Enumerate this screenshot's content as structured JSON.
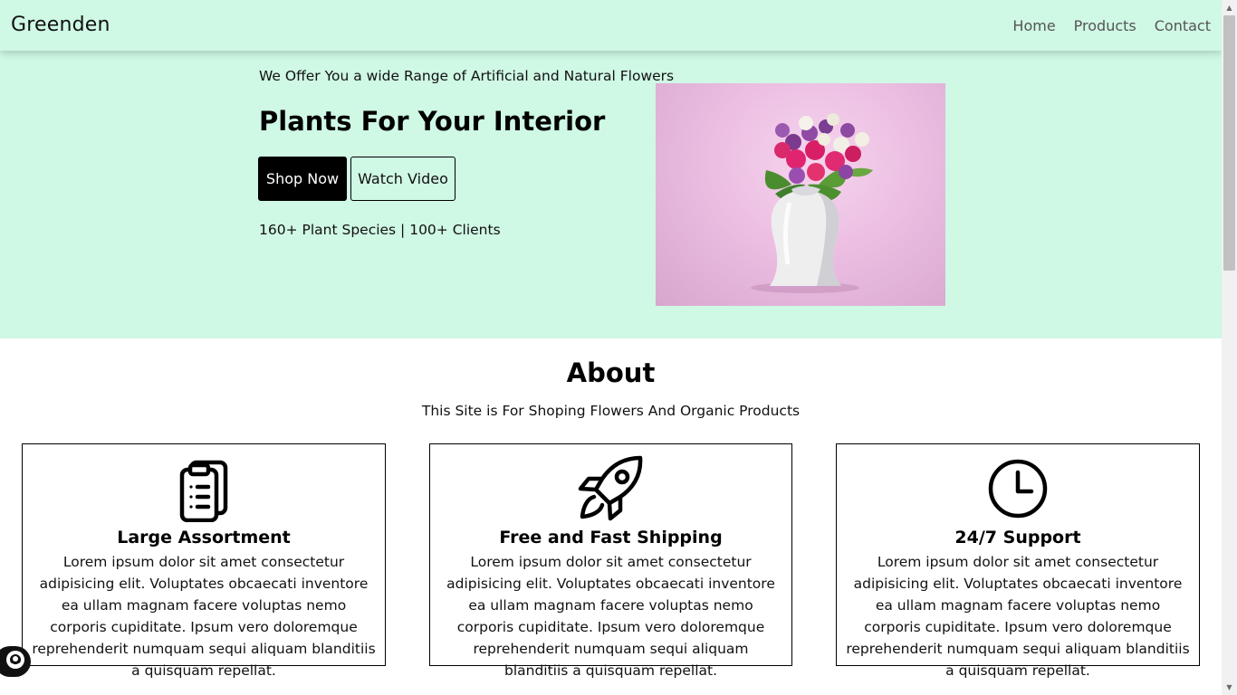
{
  "navbar": {
    "brand": "Greenden",
    "links": [
      "Home",
      "Products",
      "Contact"
    ]
  },
  "hero": {
    "subtitle": "We Offer You a wide Range of Artificial and Natural Flowers",
    "title": "Plants For Your Interior",
    "primary_button": "Shop Now",
    "secondary_button": "Watch Video",
    "stats": "160+ Plant Species | 100+ Clients",
    "image_icon": "flower-vase-image"
  },
  "about": {
    "title": "About",
    "subtitle": "This Site is For Shoping Flowers And Organic Products",
    "cards": [
      {
        "icon": "clipboard-list-icon",
        "title": "Large Assortment",
        "text": "Lorem ipsum dolor sit amet consectetur adipisicing elit. Voluptates obcaecati inventore ea ullam magnam facere voluptas nemo corporis cupiditate. Ipsum vero doloremque reprehenderit numquam sequi aliquam blanditiis a quisquam repellat."
      },
      {
        "icon": "rocket-icon",
        "title": "Free and Fast Shipping",
        "text": "Lorem ipsum dolor sit amet consectetur adipisicing elit. Voluptates obcaecati inventore ea ullam magnam facere voluptas nemo corporis cupiditate. Ipsum vero doloremque reprehenderit numquam sequi aliquam blanditiis a quisquam repellat."
      },
      {
        "icon": "clock-icon",
        "title": "24/7 Support",
        "text": "Lorem ipsum dolor sit amet consectetur adipisicing elit. Voluptates obcaecati inventore ea ullam magnam facere voluptas nemo corporis cupiditate. Ipsum vero doloremque reprehenderit numquam sequi aliquam blanditiis a quisquam repellat."
      }
    ]
  },
  "colors": {
    "hero_background": "#cff8e5",
    "primary_button": "#000000",
    "text": "#111111"
  }
}
